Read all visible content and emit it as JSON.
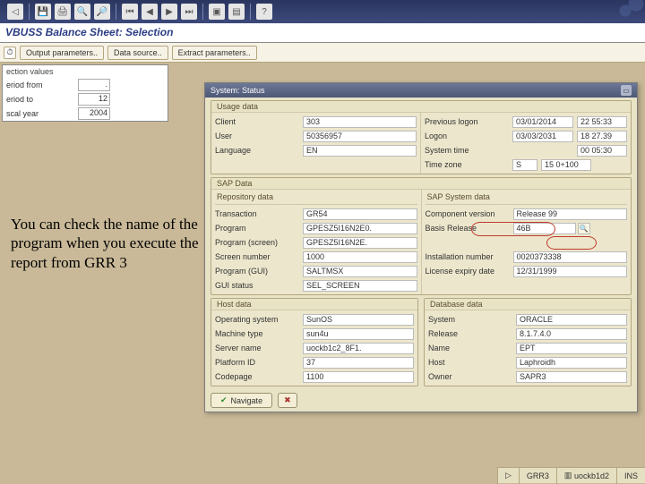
{
  "title": "VBUSS Balance Sheet: Selection",
  "sub_toolbar": {
    "btn1": "Output parameters..",
    "btn2": "Data source..",
    "btn3": "Extract parameters.."
  },
  "selection": {
    "header": "ection values",
    "rows": {
      "period_from": {
        "label": "eriod from",
        "value": "."
      },
      "period_to": {
        "label": "eriod to",
        "value": "12"
      },
      "fiscal_year": {
        "label": "scal year",
        "value": "2004"
      }
    }
  },
  "annotation": "You can check the name of the program when you execute the report from GRR 3",
  "system_status": {
    "title": "System: Status",
    "usage": {
      "header": "Usage data",
      "client": {
        "label": "Client",
        "value": "303"
      },
      "user": {
        "label": "User",
        "value": "50356957"
      },
      "language": {
        "label": "Language",
        "value": "EN"
      },
      "previous_logon": {
        "label": "Previous logon",
        "date": "03/01/2014",
        "time": "22 55:33"
      },
      "logon": {
        "label": "Logon",
        "date": "03/03/2031",
        "time": "18 27.39"
      },
      "system_time": {
        "label": "System time",
        "value": "00 05:30"
      },
      "time_zone": {
        "label": "Time zone",
        "zone": "S",
        "value": "15 0+100"
      }
    },
    "sap_header": "SAP Data",
    "repo": {
      "header": "Repository data",
      "transaction": {
        "label": "Transaction",
        "value": "GR54"
      },
      "program": {
        "label": "Program",
        "value": "GPESZ5I16N2E0."
      },
      "program_screen": {
        "label": "Program (screen)",
        "value": "GPESZ5I16N2E."
      },
      "screen_number": {
        "label": "Screen number",
        "value": "1000"
      },
      "program_gui": {
        "label": "Program (GUI)",
        "value": "SALTMSX"
      },
      "gui_status": {
        "label": "GUI status",
        "value": "SEL_SCREEN"
      }
    },
    "sys": {
      "header": "SAP System data",
      "component": {
        "label": "Component version",
        "value": "Release 99"
      },
      "basis": {
        "label": "Basis Release",
        "value": "46B"
      },
      "installation": {
        "label": "Installation number",
        "value": "0020373338"
      },
      "license": {
        "label": "License expiry date",
        "value": "12/31/1999"
      }
    },
    "host": {
      "header": "Host data",
      "os": {
        "label": "Operating system",
        "value": "SunOS"
      },
      "machine": {
        "label": "Machine type",
        "value": "sun4u"
      },
      "server": {
        "label": "Server name",
        "value": "uockb1c2_8F1."
      },
      "platform": {
        "label": "Platform ID",
        "value": "37"
      },
      "codepage": {
        "label": "Codepage",
        "value": "1100"
      }
    },
    "db": {
      "header": "Database data",
      "system": {
        "label": "System",
        "value": "ORACLE"
      },
      "release": {
        "label": "Release",
        "value": "8.1.7.4.0"
      },
      "name": {
        "label": "Name",
        "value": "EPT"
      },
      "host": {
        "label": "Host",
        "value": "Laphroidh"
      },
      "owner": {
        "label": "Owner",
        "value": "SAPR3"
      }
    },
    "buttons": {
      "navigate": "Navigate",
      "cancel": "✕"
    }
  },
  "footer": {
    "tcode": "GRR3",
    "server": "uockb1d2",
    "status": "INS"
  }
}
